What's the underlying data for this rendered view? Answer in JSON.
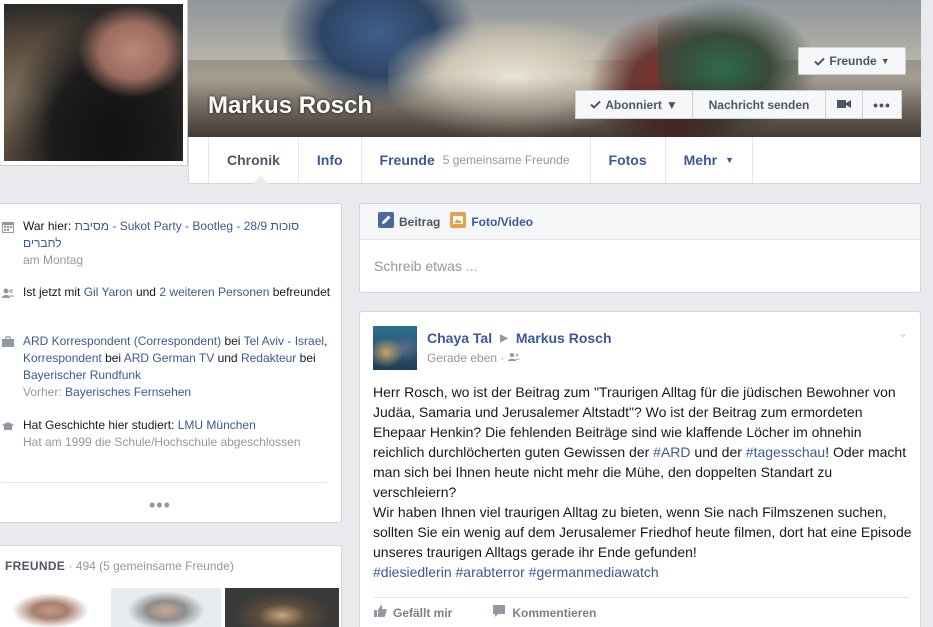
{
  "profile": {
    "name": "Markus Rosch"
  },
  "header_buttons": {
    "friends": "Freunde",
    "following": "Abonniert",
    "message": "Nachricht senden"
  },
  "tabs": [
    {
      "label": "Chronik"
    },
    {
      "label": "Info"
    },
    {
      "label": "Freunde",
      "sub": "5 gemeinsame Freunde"
    },
    {
      "label": "Fotos"
    },
    {
      "label": "Mehr"
    }
  ],
  "sidebar": {
    "items": [
      {
        "icon": "calendar-icon",
        "prefix": "War hier: ",
        "link": "מסיבת - Sukot Party - Bootleg - 28/9 סוכות לחברים",
        "sub": "am Montag"
      },
      {
        "icon": "friends-icon",
        "prefix": "Ist jetzt mit ",
        "link1": "Gil Yaron",
        "mid": " und ",
        "link2": "2 weiteren Personen",
        "suffix": " befreundet"
      },
      {
        "icon": "briefcase-icon",
        "link1": "ARD Korrespondent (Correspondent)",
        "t1": " bei ",
        "link2": "Tel Aviv - Israel",
        "t2": ", ",
        "link3": "Korrespondent",
        "t3": " bei ",
        "link4": "ARD German TV",
        "t4": " und ",
        "link5": "Redakteur",
        "t5": " bei ",
        "link6": "Bayerischer Rundfunk",
        "sub_prefix": "Vorher: ",
        "sub_link": "Bayerisches Fernsehen"
      },
      {
        "icon": "education-icon",
        "prefix": "Hat Geschichte hier studiert: ",
        "link": "LMU München",
        "sub": "Hat am 1999 die Schule/Hochschule abgeschlossen"
      }
    ],
    "more": "•••"
  },
  "friends_box": {
    "title": "FREUNDE",
    "count": " · 494 (5 gemeinsame Freunde)"
  },
  "composer": {
    "tab_post": "Beitrag",
    "tab_photo": "Foto/Video",
    "placeholder": "Schreib etwas ..."
  },
  "post": {
    "author": "Chaya Tal",
    "target": "Markus Rosch",
    "time": "Gerade eben · ",
    "text1": "Herr Rosch, wo ist der Beitrag zum \"Traurigen Alltag für die jüdischen Bewohner von Judäa, Samaria und Jerusalemer Altstadt\"? Wo ist der Beitrag zum ermordeten Ehepaar Henkin? Die fehlenden Beiträge sind wie klaffende Löcher im ohnehin reichlich durchlöcherten guten Gewissen der ",
    "tag1": "#ARD",
    "text2": " und der ",
    "tag2": "#tagesschau",
    "text3": "! Oder macht man sich bei Ihnen heute nicht mehr die Mühe, den doppelten Standart zu verschleiern?",
    "text4": "Wir haben Ihnen viel traurigen Alltag zu bieten, wenn Sie nach Filmszenen suchen, sollten Sie ein wenig auf dem Jerusalemer Friedhof heute filmen, dort hat eine Episode unseres traurigen Alltags gerade ihr Ende gefunden!",
    "tag3": "#diesiedlerin",
    "tag4": "#arabterror",
    "tag5": "#germanmediawatch",
    "like": "Gefällt mir",
    "comment": "Kommentieren"
  },
  "colors": {
    "link": "#3b5998",
    "muted": "#9197a3",
    "background": "#e9eaed"
  }
}
